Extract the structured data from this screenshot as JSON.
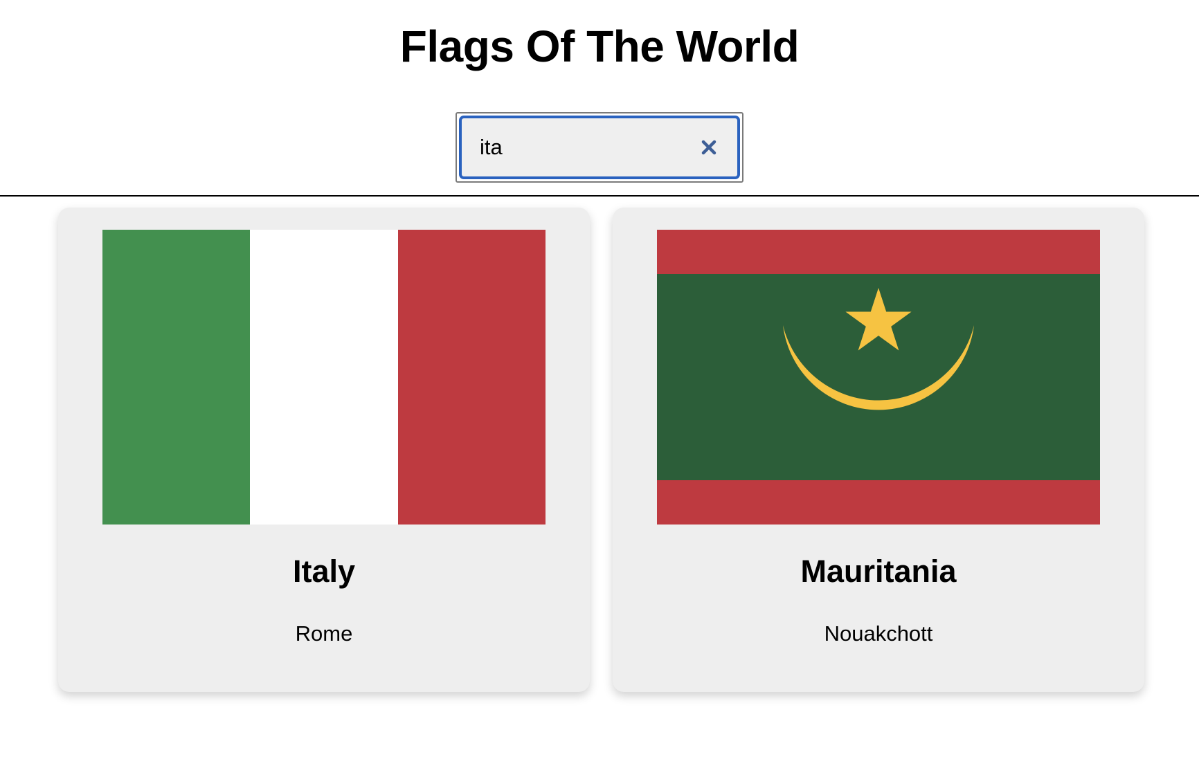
{
  "header": {
    "title": "Flags Of The World"
  },
  "search": {
    "value": "ita",
    "clear_icon": "close-icon"
  },
  "results": [
    {
      "country": "Italy",
      "capital": "Rome",
      "flag": {
        "type": "vertical-tricolor",
        "colors": [
          "#43904f",
          "#ffffff",
          "#be3a40"
        ]
      }
    },
    {
      "country": "Mauritania",
      "capital": "Nouakchott",
      "flag": {
        "type": "bands-with-crescent-star",
        "colors": [
          "#be3a40",
          "#2c5e39",
          "#f6c342"
        ]
      }
    }
  ]
}
